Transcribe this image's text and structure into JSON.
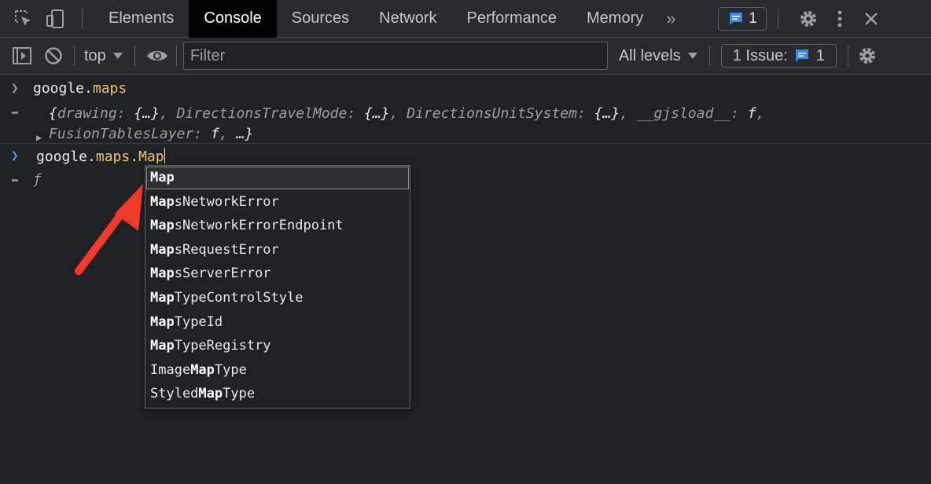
{
  "tabs": {
    "items": [
      "Elements",
      "Console",
      "Sources",
      "Network",
      "Performance",
      "Memory"
    ],
    "more": "»",
    "messages_count": "1"
  },
  "toolbar": {
    "context": "top",
    "filter_placeholder": "Filter",
    "levels": "All levels",
    "issues_label": "1 Issue:",
    "issues_count": "1"
  },
  "console": {
    "entry1": {
      "cmd_prefix": "google.",
      "cmd_prop": "maps"
    },
    "result1": {
      "l1": "drawing",
      "l2": "DirectionsTravelMode",
      "l3": "DirectionsUnitSystem",
      "l4": "__gjsload__",
      "l5": "FusionTa",
      "l6": "blesLayer",
      "obj": "{…}",
      "fn": "f",
      "ellipsis": "…"
    },
    "entry2": {
      "cmd_prefix": "google.",
      "cmd_prop": "maps",
      "cmd_typed": "Map"
    },
    "result2": "ƒ"
  },
  "autocomplete": {
    "items": [
      {
        "pre": "",
        "match": "Map",
        "post": ""
      },
      {
        "pre": "",
        "match": "Map",
        "post": "sNetworkError"
      },
      {
        "pre": "",
        "match": "Map",
        "post": "sNetworkErrorEndpoint"
      },
      {
        "pre": "",
        "match": "Map",
        "post": "sRequestError"
      },
      {
        "pre": "",
        "match": "Map",
        "post": "sServerError"
      },
      {
        "pre": "",
        "match": "Map",
        "post": "TypeControlStyle"
      },
      {
        "pre": "",
        "match": "Map",
        "post": "TypeId"
      },
      {
        "pre": "",
        "match": "Map",
        "post": "TypeRegistry"
      },
      {
        "pre": "Image",
        "match": "Map",
        "post": "Type"
      },
      {
        "pre": "Styled",
        "match": "Map",
        "post": "Type"
      }
    ],
    "selected_index": 0
  },
  "colors": {
    "accent_blue": "#4d9bf0",
    "arrow_red": "#f03a2a",
    "property_yellow": "#f1c26e"
  }
}
